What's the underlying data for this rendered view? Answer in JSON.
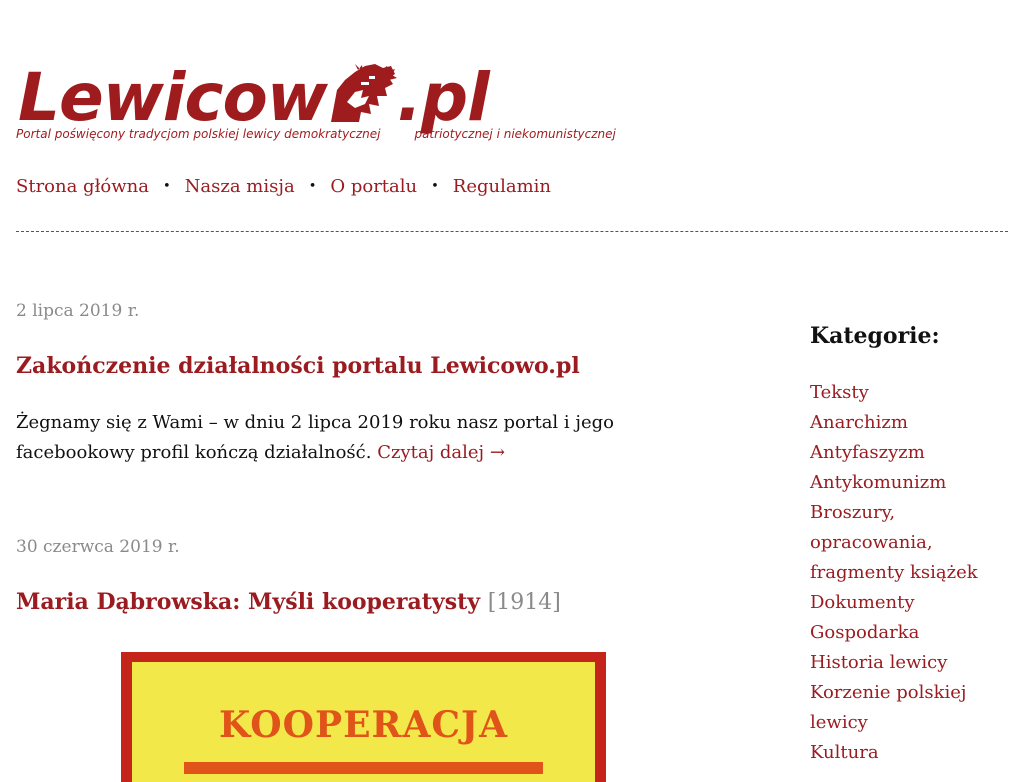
{
  "logo": {
    "word_start": "Lewicow",
    "word_end": ".pl",
    "tagline_1": "Portal poświęcony tradycjom polskiej lewicy demokratycznej",
    "tagline_2": "patriotycznej i niekomunistycznej"
  },
  "nav": {
    "items": [
      {
        "label": "Strona główna"
      },
      {
        "label": "Nasza misja"
      },
      {
        "label": "O portalu"
      },
      {
        "label": "Regulamin"
      }
    ],
    "separator": "•"
  },
  "posts": [
    {
      "date": "2 lipca 2019 r.",
      "title": "Zakończenie działalności portalu Lewicowo.pl",
      "excerpt": "Żegnamy się z Wami – w dniu 2 lipca 2019 roku nasz portal i jego facebookowy profil kończą działalność.",
      "read_more": "Czytaj dalej →"
    },
    {
      "date": "30 czerwca 2019 r.",
      "title": "Maria Dąbrowska: Myśli kooperatysty",
      "year": "[1914]",
      "image_text": "KOOPERACJA"
    }
  ],
  "sidebar": {
    "heading": "Kategorie:",
    "categories": [
      {
        "label": "Teksty"
      },
      {
        "label": "Anarchizm"
      },
      {
        "label": "Antyfaszyzm"
      },
      {
        "label": "Antykomunizm"
      },
      {
        "label": "Broszury, opracowania, fragmenty książek"
      },
      {
        "label": "Dokumenty"
      },
      {
        "label": "Gospodarka"
      },
      {
        "label": "Historia lewicy"
      },
      {
        "label": "Korzenie polskiej lewicy"
      },
      {
        "label": "Kultura"
      }
    ]
  },
  "colors": {
    "brand": "#9e1b1e",
    "link": "#9a1c20",
    "meta": "#8a8a8a",
    "book_frame": "#c4241a",
    "book_paper": "#f3e84a",
    "book_ink": "#e0541a"
  }
}
